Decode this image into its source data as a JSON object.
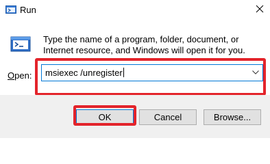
{
  "window": {
    "title": "Run",
    "close_icon": "close-icon"
  },
  "body": {
    "description": "Type the name of a program, folder, document, or Internet resource, and Windows will open it for you.",
    "open_label_prefix": "O",
    "open_label_rest": "pen:",
    "command_value": "msiexec /unregister"
  },
  "buttons": {
    "ok": "OK",
    "cancel": "Cancel",
    "browse": "Browse..."
  },
  "colors": {
    "highlight": "#e3242b",
    "focus": "#0078d7"
  }
}
